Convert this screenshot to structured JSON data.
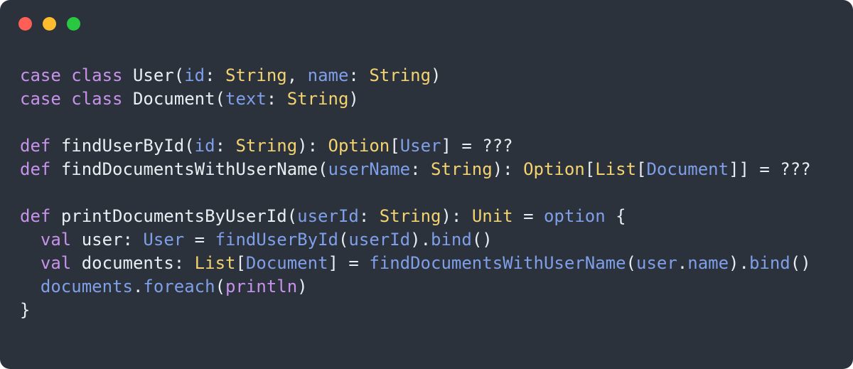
{
  "window": {
    "background_color": "#2b323c",
    "corner_radius_px": 14,
    "traffic_lights": [
      {
        "name": "close",
        "color": "#ff5f57"
      },
      {
        "name": "minimize",
        "color": "#febc2e"
      },
      {
        "name": "maximize",
        "color": "#28c840"
      }
    ]
  },
  "theme": {
    "keyword_color": "#c792ea",
    "type_color": "#f3d270",
    "identifier_color": "#7f9fe8",
    "plain_color": "#e9eef2"
  },
  "code": {
    "language": "scala",
    "font_size_px": 24,
    "line_height_px": 33,
    "plain_text": "case class User(id: String, name: String)\ncase class Document(text: String)\n\ndef findUserById(id: String): Option[User] = ???\ndef findDocumentsWithUserName(userName: String): Option[List[Document]] = ???\n\ndef printDocumentsByUserId(userId: String): Unit = option {\n  val user: User = findUserById(userId).bind()\n  val documents: List[Document] = findDocumentsWithUserName(user.name).bind()\n  documents.foreach(println)\n}",
    "lines": [
      {
        "number": 1,
        "tokens": [
          {
            "t": "case",
            "c": "kw"
          },
          {
            "t": " ",
            "c": "pln"
          },
          {
            "t": "class",
            "c": "kw"
          },
          {
            "t": " ",
            "c": "pln"
          },
          {
            "t": "User",
            "c": "pln"
          },
          {
            "t": "(",
            "c": "pln"
          },
          {
            "t": "id",
            "c": "id"
          },
          {
            "t": ": ",
            "c": "pln"
          },
          {
            "t": "String",
            "c": "typ"
          },
          {
            "t": ", ",
            "c": "pln"
          },
          {
            "t": "name",
            "c": "id"
          },
          {
            "t": ": ",
            "c": "pln"
          },
          {
            "t": "String",
            "c": "typ"
          },
          {
            "t": ")",
            "c": "pln"
          }
        ]
      },
      {
        "number": 2,
        "tokens": [
          {
            "t": "case",
            "c": "kw"
          },
          {
            "t": " ",
            "c": "pln"
          },
          {
            "t": "class",
            "c": "kw"
          },
          {
            "t": " ",
            "c": "pln"
          },
          {
            "t": "Document",
            "c": "pln"
          },
          {
            "t": "(",
            "c": "pln"
          },
          {
            "t": "text",
            "c": "id"
          },
          {
            "t": ": ",
            "c": "pln"
          },
          {
            "t": "String",
            "c": "typ"
          },
          {
            "t": ")",
            "c": "pln"
          }
        ]
      },
      {
        "number": 3,
        "tokens": []
      },
      {
        "number": 4,
        "tokens": [
          {
            "t": "def",
            "c": "kw"
          },
          {
            "t": " ",
            "c": "pln"
          },
          {
            "t": "findUserById",
            "c": "pln"
          },
          {
            "t": "(",
            "c": "pln"
          },
          {
            "t": "id",
            "c": "id"
          },
          {
            "t": ": ",
            "c": "pln"
          },
          {
            "t": "String",
            "c": "typ"
          },
          {
            "t": "): ",
            "c": "pln"
          },
          {
            "t": "Option",
            "c": "typ"
          },
          {
            "t": "[",
            "c": "pln"
          },
          {
            "t": "User",
            "c": "id"
          },
          {
            "t": "] = ???",
            "c": "pln"
          }
        ]
      },
      {
        "number": 5,
        "tokens": [
          {
            "t": "def",
            "c": "kw"
          },
          {
            "t": " ",
            "c": "pln"
          },
          {
            "t": "findDocumentsWithUserName",
            "c": "pln"
          },
          {
            "t": "(",
            "c": "pln"
          },
          {
            "t": "userName",
            "c": "id"
          },
          {
            "t": ": ",
            "c": "pln"
          },
          {
            "t": "String",
            "c": "typ"
          },
          {
            "t": "): ",
            "c": "pln"
          },
          {
            "t": "Option",
            "c": "typ"
          },
          {
            "t": "[",
            "c": "pln"
          },
          {
            "t": "List",
            "c": "typ"
          },
          {
            "t": "[",
            "c": "pln"
          },
          {
            "t": "Document",
            "c": "id"
          },
          {
            "t": "]] = ???",
            "c": "pln"
          }
        ]
      },
      {
        "number": 6,
        "tokens": []
      },
      {
        "number": 7,
        "tokens": [
          {
            "t": "def",
            "c": "kw"
          },
          {
            "t": " ",
            "c": "pln"
          },
          {
            "t": "printDocumentsByUserId",
            "c": "pln"
          },
          {
            "t": "(",
            "c": "pln"
          },
          {
            "t": "userId",
            "c": "id"
          },
          {
            "t": ": ",
            "c": "pln"
          },
          {
            "t": "String",
            "c": "typ"
          },
          {
            "t": "): ",
            "c": "pln"
          },
          {
            "t": "Unit",
            "c": "typ"
          },
          {
            "t": " = ",
            "c": "pln"
          },
          {
            "t": "option",
            "c": "id"
          },
          {
            "t": " {",
            "c": "pln"
          }
        ]
      },
      {
        "number": 8,
        "tokens": [
          {
            "t": "  ",
            "c": "pln"
          },
          {
            "t": "val",
            "c": "kw"
          },
          {
            "t": " ",
            "c": "pln"
          },
          {
            "t": "user",
            "c": "pln"
          },
          {
            "t": ": ",
            "c": "pln"
          },
          {
            "t": "User",
            "c": "id"
          },
          {
            "t": " = ",
            "c": "pln"
          },
          {
            "t": "findUserById",
            "c": "id"
          },
          {
            "t": "(",
            "c": "pln"
          },
          {
            "t": "userId",
            "c": "id"
          },
          {
            "t": ")",
            "c": "pln"
          },
          {
            "t": ".",
            "c": "pln"
          },
          {
            "t": "bind",
            "c": "id"
          },
          {
            "t": "()",
            "c": "pln"
          }
        ]
      },
      {
        "number": 9,
        "tokens": [
          {
            "t": "  ",
            "c": "pln"
          },
          {
            "t": "val",
            "c": "kw"
          },
          {
            "t": " ",
            "c": "pln"
          },
          {
            "t": "documents",
            "c": "pln"
          },
          {
            "t": ": ",
            "c": "pln"
          },
          {
            "t": "List",
            "c": "typ"
          },
          {
            "t": "[",
            "c": "pln"
          },
          {
            "t": "Document",
            "c": "id"
          },
          {
            "t": "] = ",
            "c": "pln"
          },
          {
            "t": "findDocumentsWithUserName",
            "c": "id"
          },
          {
            "t": "(",
            "c": "pln"
          },
          {
            "t": "user",
            "c": "id"
          },
          {
            "t": ".",
            "c": "pln"
          },
          {
            "t": "name",
            "c": "id"
          },
          {
            "t": ")",
            "c": "pln"
          },
          {
            "t": ".",
            "c": "pln"
          },
          {
            "t": "bind",
            "c": "id"
          },
          {
            "t": "()",
            "c": "pln"
          }
        ]
      },
      {
        "number": 10,
        "tokens": [
          {
            "t": "  ",
            "c": "pln"
          },
          {
            "t": "documents",
            "c": "id"
          },
          {
            "t": ".",
            "c": "pln"
          },
          {
            "t": "foreach",
            "c": "id"
          },
          {
            "t": "(",
            "c": "pln"
          },
          {
            "t": "println",
            "c": "kw"
          },
          {
            "t": ")",
            "c": "pln"
          }
        ]
      },
      {
        "number": 11,
        "tokens": [
          {
            "t": "}",
            "c": "pln"
          }
        ]
      }
    ]
  }
}
